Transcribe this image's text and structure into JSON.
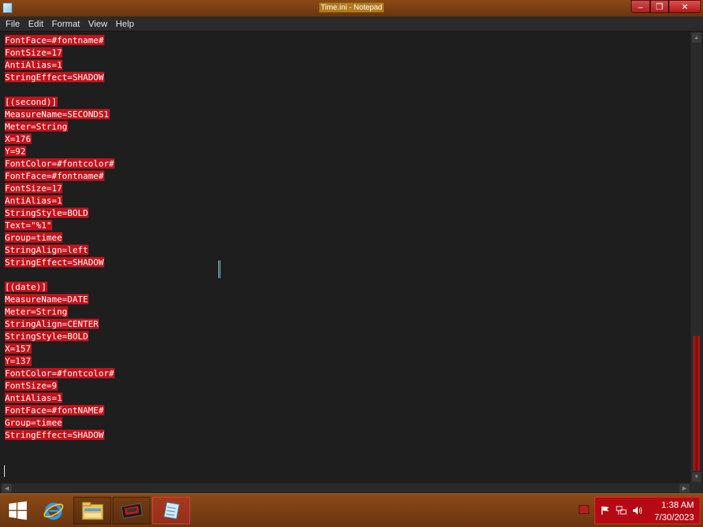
{
  "window": {
    "title": "Time.ini - Notepad",
    "minimize_glyph": "–",
    "restore_glyph": "❐",
    "close_glyph": "✕"
  },
  "menu": [
    "File",
    "Edit",
    "Format",
    "View",
    "Help"
  ],
  "editor": {
    "lines": [
      "FontFace=#fontname#",
      "FontSize=17",
      "AntiAlias=1",
      "StringEffect=SHADOW",
      "",
      "[(second)]",
      "MeasureName=SECONDS1",
      "Meter=String",
      "X=176",
      "Y=92",
      "FontColor=#fontcolor#",
      "FontFace=#fontname#",
      "FontSize=17",
      "AntiAlias=1",
      "StringStyle=BOLD",
      "Text=\"%1\"",
      "Group=timee",
      "StringAlign=left",
      "StringEffect=SHADOW",
      "",
      "[(date)]",
      "MeasureName=DATE",
      "Meter=String",
      "StringAlign=CENTER",
      "StringStyle=BOLD",
      "X=157",
      "Y=137",
      "FontColor=#fontcolor#",
      "FontSize=9",
      "AntiAlias=1",
      "FontFace=#fontNAME#",
      "Group=timee",
      "StringEffect=SHADOW"
    ],
    "selection_color": "#c4121b"
  },
  "taskbar": {
    "buttons": [
      {
        "name": "internet-explorer-icon"
      },
      {
        "name": "file-explorer-icon"
      },
      {
        "name": "app-icon"
      },
      {
        "name": "notepad-icon"
      }
    ],
    "clock": {
      "time": "1:38 AM",
      "date": "7/30/2023"
    }
  },
  "colors": {
    "titlebar": "#7a3e12",
    "accent_red": "#c21a1a",
    "editor_bg": "#1e1e1e"
  }
}
